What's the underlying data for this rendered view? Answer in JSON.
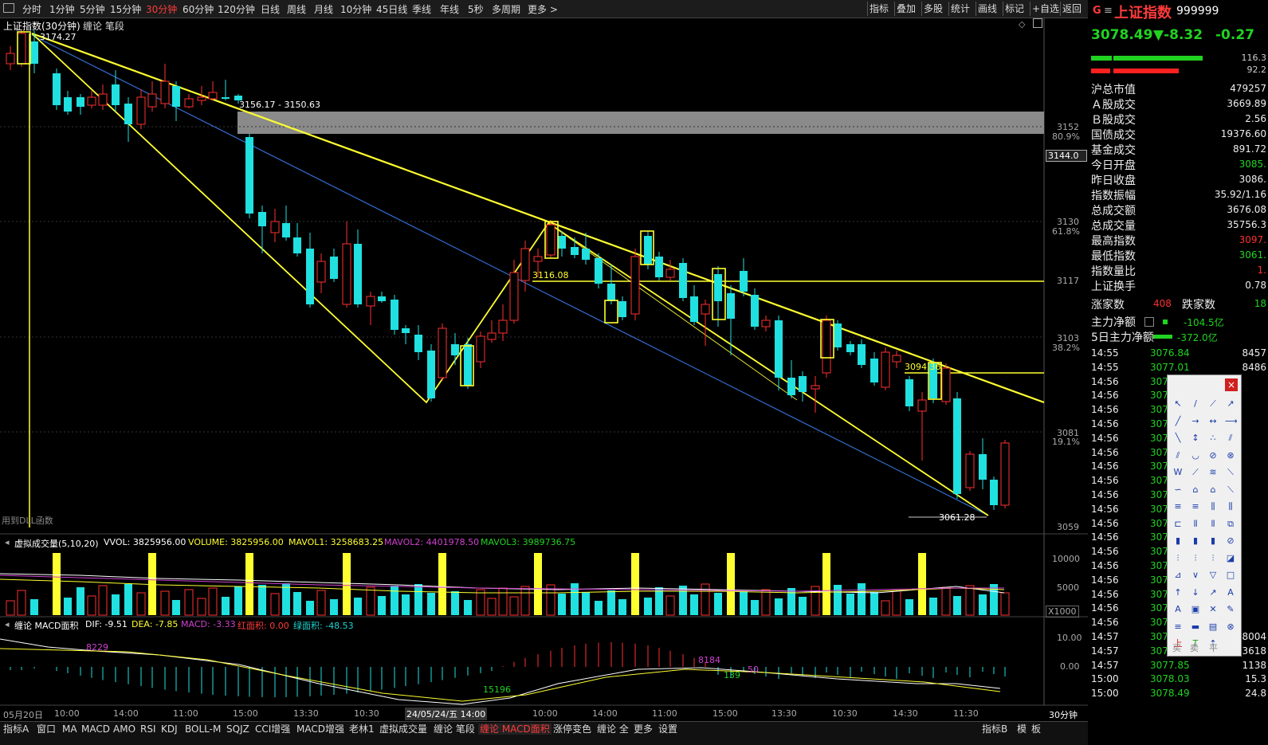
{
  "toolbar": {
    "periods": [
      "分时",
      "1分钟",
      "5分钟",
      "15分钟",
      "30分钟",
      "60分钟",
      "120分钟",
      "日线",
      "周线",
      "月线",
      "10分钟",
      "45日线",
      "季线",
      "年线",
      "5秒",
      "多周期",
      "更多 >"
    ],
    "active_period": "30分钟",
    "tools": [
      "指标",
      "叠加",
      "多股",
      "统计",
      "画线",
      "标记",
      "+自选",
      "返回"
    ]
  },
  "chart": {
    "title": "上证指数(30分钟)",
    "indicator": "缠论 笔段",
    "high_label": "3174.27",
    "zone_label": "3156.17 - 3150.63",
    "level_label_1": "3116.08",
    "level_label_2": "3094.36",
    "low_label": "3061.28",
    "dll_note": "用到DLL函数",
    "price_axis": [
      "3152",
      "3130",
      "3117",
      "3103",
      "3081",
      "3059"
    ],
    "pct_axis": [
      "80.9%",
      "61.8%",
      "38.2%",
      "19.1%"
    ],
    "current_price_box": "3144.0"
  },
  "volume": {
    "title": "虚拟成交量(5,10,20)",
    "vvol": "VVOL: 3825956.00",
    "volume": "VOLUME: 3825956.00",
    "mavol1": "MAVOL1: 3258683.25",
    "mavol2": "MAVOL2: 4401978.50",
    "mavol3": "MAVOL3: 3989736.75",
    "axis": [
      "10000",
      "5000"
    ],
    "unit": "X1000"
  },
  "macd": {
    "title": "缠论 MACD面积",
    "dif": "DIF: -9.51",
    "dea": "DEA: -7.85",
    "macd": "MACD: -3.33",
    "red_area": "红面积: 0.00",
    "green_area": "绿面积: -48.53",
    "axis": [
      "10.00",
      "0.00"
    ],
    "annotations": [
      "8229",
      "15196",
      "8184",
      "139",
      "50"
    ]
  },
  "time_axis": {
    "labels": [
      "05月20日",
      "10:00",
      "14:00",
      "11:00",
      "15:00",
      "13:30",
      "10:30",
      "14:00",
      "10:00",
      "14:00",
      "11:00",
      "15:00",
      "13:30",
      "10:30",
      "14:30",
      "11:30"
    ],
    "cursor_label": "24/05/24/五 14:00",
    "period_label": "30分钟"
  },
  "bottom_tabs": [
    "指标A",
    "窗口",
    "MA",
    "MACD",
    "AMO",
    "RSI",
    "KDJ",
    "BOLL-M",
    "SQJZ",
    "CCI增强",
    "MACD增强",
    "老林1",
    "虚拟成交量",
    "缠论 笔段",
    "缠论 MACD面积",
    "涨停变色",
    "缠论 全",
    "更多",
    "设置"
  ],
  "bottom_active_tab": "缠论 MACD面积",
  "bottom_right": [
    "指标B",
    "模",
    "板"
  ],
  "quote": {
    "logo": "G",
    "name": "上证指数",
    "code": "999999",
    "price": "3078.49",
    "change": "▼-8.32",
    "change_pct": "-0.27",
    "bar_values": [
      "116.3",
      "92.2"
    ],
    "rows": [
      {
        "label": "沪总市值",
        "value": "479257",
        "color": "#eeeeee"
      },
      {
        "label": "Ａ股成交",
        "value": "3669.89",
        "color": "#eeeeee"
      },
      {
        "label": "Ｂ股成交",
        "value": "2.56",
        "color": "#eeeeee"
      },
      {
        "label": "国债成交",
        "value": "19376.60",
        "color": "#eeeeee"
      },
      {
        "label": "基金成交",
        "value": "891.72",
        "color": "#eeeeee"
      },
      {
        "label": "今日开盘",
        "value": "3085.",
        "color": "#21d321"
      },
      {
        "label": "昨日收盘",
        "value": "3086.",
        "color": "#eeeeee"
      },
      {
        "label": "指数振幅",
        "value": "35.92/1.16",
        "color": "#eeeeee"
      },
      {
        "label": "总成交额",
        "value": "3676.08",
        "color": "#eeeeee"
      },
      {
        "label": "总成交量",
        "value": "35756.3",
        "color": "#eeeeee"
      },
      {
        "label": "最高指数",
        "value": "3097.",
        "color": "#ff3030"
      },
      {
        "label": "最低指数",
        "value": "3061.",
        "color": "#21d321"
      },
      {
        "label": "指数量比",
        "value": "1.",
        "color": "#ff3030"
      },
      {
        "label": "上证换手",
        "value": "0.78",
        "color": "#eeeeee"
      }
    ],
    "up_label": "涨家数",
    "up_value": "408",
    "down_label": "跌家数",
    "down_value": "18",
    "main_net_label": "主力净额",
    "main_net_value": "-104.5亿",
    "main_net5_label": "5日主力净额",
    "main_net5_value": "-372.0亿"
  },
  "ticks": [
    {
      "time": "14:55",
      "price": "3076.84",
      "vol": "8457"
    },
    {
      "time": "14:55",
      "price": "3077.01",
      "vol": "8486"
    },
    {
      "time": "14:56",
      "price": "307",
      "vol": ""
    },
    {
      "time": "14:56",
      "price": "307",
      "vol": ""
    },
    {
      "time": "14:56",
      "price": "307",
      "vol": ""
    },
    {
      "time": "14:56",
      "price": "307",
      "vol": ""
    },
    {
      "time": "14:56",
      "price": "307",
      "vol": ""
    },
    {
      "time": "14:56",
      "price": "307",
      "vol": ""
    },
    {
      "time": "14:56",
      "price": "307",
      "vol": ""
    },
    {
      "time": "14:56",
      "price": "307",
      "vol": ""
    },
    {
      "time": "14:56",
      "price": "307",
      "vol": ""
    },
    {
      "time": "14:56",
      "price": "307",
      "vol": ""
    },
    {
      "time": "14:56",
      "price": "307",
      "vol": ""
    },
    {
      "time": "14:56",
      "price": "307",
      "vol": ""
    },
    {
      "time": "14:56",
      "price": "307",
      "vol": ""
    },
    {
      "time": "14:56",
      "price": "307",
      "vol": ""
    },
    {
      "time": "14:56",
      "price": "307",
      "vol": ""
    },
    {
      "time": "14:56",
      "price": "307",
      "vol": ""
    },
    {
      "time": "14:56",
      "price": "307",
      "vol": ""
    },
    {
      "time": "14:56",
      "price": "307",
      "vol": ""
    },
    {
      "time": "14:57",
      "price": "3077.87",
      "vol": "8004"
    },
    {
      "time": "14:57",
      "price": "3077.78",
      "vol": "3618"
    },
    {
      "time": "14:57",
      "price": "3077.85",
      "vol": "1138"
    },
    {
      "time": "15:00",
      "price": "3078.03",
      "vol": "15.3"
    },
    {
      "time": "15:00",
      "price": "3078.49",
      "vol": "24.8"
    }
  ],
  "palette": {
    "close": "×",
    "bottom": [
      "买",
      "卖",
      "平"
    ]
  }
}
